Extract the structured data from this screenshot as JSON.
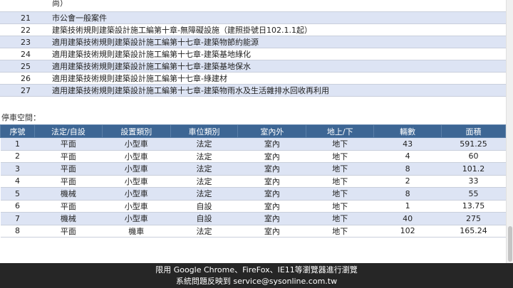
{
  "regulations": {
    "rows": [
      {
        "no": "",
        "text": "尚）"
      },
      {
        "no": "21",
        "text": "市公會一般案件"
      },
      {
        "no": "22",
        "text": "建築技術規則建築設計施工編第十章-無障礙設施（建照掛號日102.1.1起）"
      },
      {
        "no": "23",
        "text": "適用建築技術規則建築設計施工編第十七章-建築物節約能源"
      },
      {
        "no": "24",
        "text": "適用建築技術規則建築設計施工編第十七章-建築基地綠化"
      },
      {
        "no": "25",
        "text": "適用建築技術規則建築設計施工編第十七章-建築基地保水"
      },
      {
        "no": "26",
        "text": "適用建築技術規則建築設計施工編第十七章-綠建材"
      },
      {
        "no": "27",
        "text": "適用建築技術規則建築設計施工編第十七章-建築物雨水及生活雜排水回收再利用"
      }
    ]
  },
  "parking": {
    "label": "停車空間：",
    "headers": [
      "序號",
      "法定/自設",
      "設置類別",
      "車位類別",
      "室內外",
      "地上/下",
      "輛數",
      "面積"
    ],
    "rows": [
      [
        "1",
        "平面",
        "小型車",
        "法定",
        "室內",
        "地下",
        "43",
        "591.25"
      ],
      [
        "2",
        "平面",
        "小型車",
        "法定",
        "室內",
        "地下",
        "4",
        "60"
      ],
      [
        "3",
        "平面",
        "小型車",
        "法定",
        "室內",
        "地下",
        "8",
        "101.2"
      ],
      [
        "4",
        "平面",
        "小型車",
        "法定",
        "室內",
        "地下",
        "2",
        "33"
      ],
      [
        "5",
        "機械",
        "小型車",
        "法定",
        "室內",
        "地下",
        "8",
        "55"
      ],
      [
        "6",
        "平面",
        "小型車",
        "自設",
        "室內",
        "地下",
        "1",
        "13.75"
      ],
      [
        "7",
        "機械",
        "小型車",
        "自設",
        "室內",
        "地下",
        "40",
        "275"
      ],
      [
        "8",
        "平面",
        "機車",
        "法定",
        "室內",
        "地下",
        "102",
        "165.24"
      ]
    ]
  },
  "footer": {
    "line1": "限用 Google Chrome、FireFox、IE11等瀏覽器進行瀏覽",
    "line2": "系統問題反映到 service@sysonline.com.tw"
  },
  "colors": {
    "header_bg": "#3d6694",
    "stripe": "#dde4f4",
    "footer_bg": "#262626"
  }
}
